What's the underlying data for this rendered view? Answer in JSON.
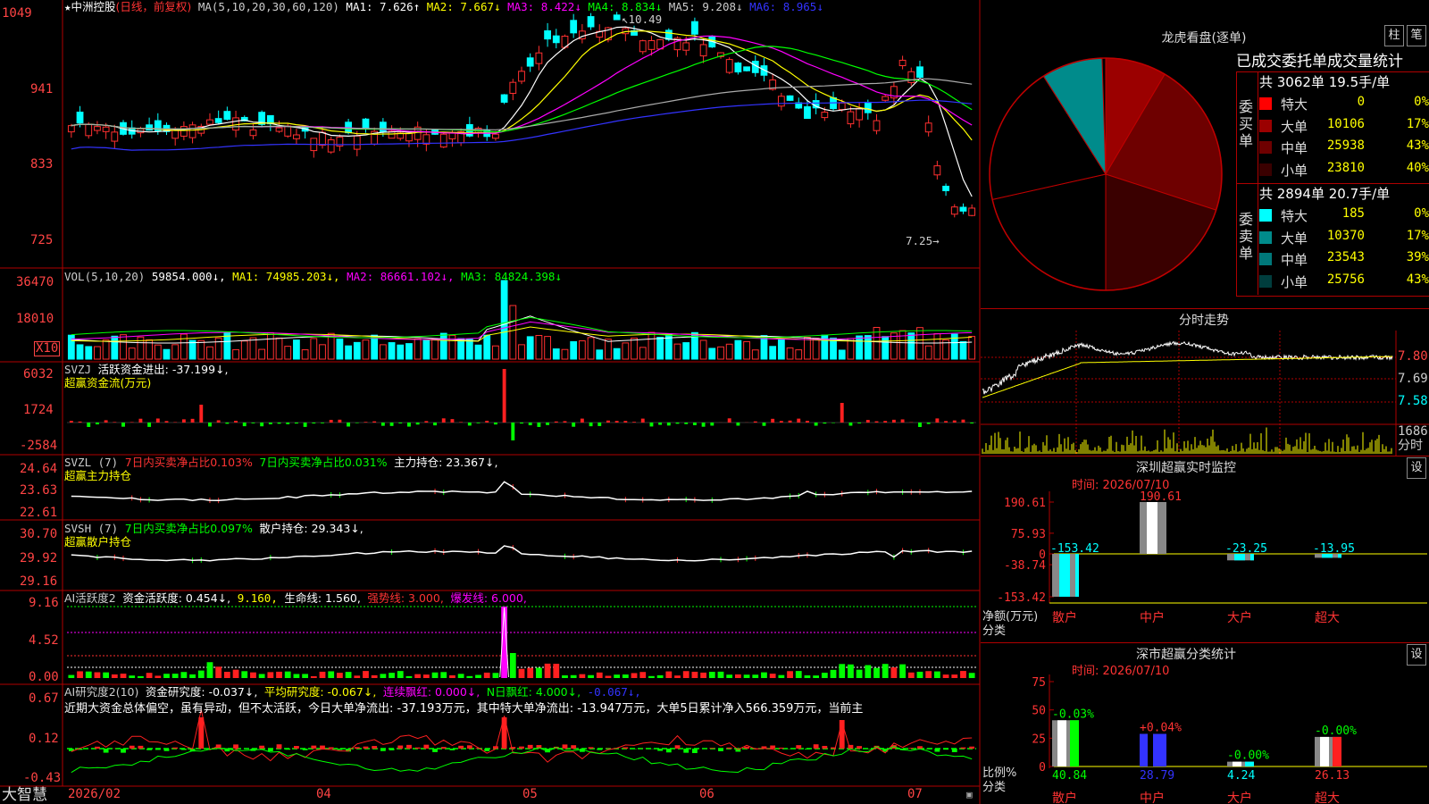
{
  "stock": {
    "name": "中洲控股",
    "mode": "(日线，前复权)",
    "ma_header": "MA(5,10,20,30,60,120)",
    "ma1": "MA1: 7.626↑",
    "ma2": "MA2: 7.667↓",
    "ma3": "MA3: 8.422↓",
    "ma4": "MA4: 8.834↓",
    "ma5": "MA5: 9.208↓",
    "ma6": "MA6: 8.965↓",
    "high_label": "10.49",
    "low_label": "7.25"
  },
  "price_axis": [
    "1049",
    "941",
    "833",
    "725"
  ],
  "vol": {
    "header": "VOL(5,10,20)",
    "v": "59854.000↓,",
    "ma1": "MA1: 74985.203↓,",
    "ma2": "MA2: 86661.102↓,",
    "ma3": "MA3: 84824.398↓",
    "axis": [
      "36470",
      "18010"
    ],
    "unit": "X10"
  },
  "svzj": {
    "header": "SVZJ",
    "line": "活跃资金进出: -37.199↓,",
    "sub": "超赢资金流(万元)",
    "axis": [
      "6032",
      "1724",
      "-2584"
    ]
  },
  "svzl": {
    "header": "SVZL (7)",
    "p1": "7日内买卖净占比0.103%",
    "p2": "7日内买卖净占比0.031%",
    "p3": "主力持仓: 23.367↓,",
    "sub": "超赢主力持仓",
    "axis": [
      "24.64",
      "23.63",
      "22.61"
    ]
  },
  "svsh": {
    "header": "SVSH (7)",
    "p1": "7日内买卖净占比0.097%",
    "p2": "散户持仓: 29.343↓,",
    "sub": "超赢散户持仓",
    "axis": [
      "30.70",
      "29.92",
      "29.16"
    ]
  },
  "ai1": {
    "header": "AI活跃度2",
    "p1": "资金活跃度: 0.454↓,",
    "p2": "9.160,",
    "p3": "生命线: 1.560,",
    "p4": "强势线: 3.000,",
    "p5": "爆发线: 6.000,",
    "axis": [
      "9.16",
      "4.52",
      "0.00"
    ]
  },
  "ai2": {
    "header": "AI研究度2(10)",
    "p1": "资金研究度: -0.037↓,",
    "p2": "平均研究度: -0.067↓,",
    "p3": "连续飘红: 0.000↓,",
    "p4": "N日飘红: 4.000↓,",
    "p5": "-0.067↓,",
    "desc": "近期大资金总体偏空，虽有异动，但不太活跃，今日大单净流出: -37.193万元，其中特大单净流出: -13.947万元，大单5日累计净入566.359万元，当前主",
    "axis": [
      "0.67",
      "0.12",
      "-0.43"
    ]
  },
  "bottom": {
    "brand": "大智慧",
    "dates": [
      "2026/02",
      "04",
      "05",
      "06",
      "07"
    ]
  },
  "dragon": {
    "title": "龙虎看盘(逐单)",
    "btn1": "柱",
    "btn2": "笔",
    "subtitle": "已成交委托单成交量统计",
    "buy_label": "委买单",
    "sell_label": "委卖单",
    "buy_total": "共 3062单 19.5手/单",
    "sell_total": "共 2894单 20.7手/单",
    "buy_rows": [
      {
        "name": "特大",
        "value": "0",
        "pct": "0%",
        "color": "#ff0000"
      },
      {
        "name": "大单",
        "value": "10106",
        "pct": "17%",
        "color": "#9b0000"
      },
      {
        "name": "中单",
        "value": "25938",
        "pct": "43%",
        "color": "#6e0000"
      },
      {
        "name": "小单",
        "value": "23810",
        "pct": "40%",
        "color": "#3a0000"
      }
    ],
    "sell_rows": [
      {
        "name": "特大",
        "value": "185",
        "pct": "0%",
        "color": "#00ffff"
      },
      {
        "name": "大单",
        "value": "10370",
        "pct": "17%",
        "color": "#008b8b"
      },
      {
        "name": "中单",
        "value": "23543",
        "pct": "39%",
        "color": "#00787a"
      },
      {
        "name": "小单",
        "value": "25756",
        "pct": "43%",
        "color": "#003d3d"
      }
    ]
  },
  "intraday": {
    "title": "分时走势",
    "axis": [
      "7.80",
      "7.69",
      "7.58"
    ],
    "vol_axis": "1686",
    "vol_unit": "分时"
  },
  "sz_monitor": {
    "title": "深圳超赢实时监控",
    "btn": "设",
    "time": "时间: 2026/07/10",
    "axis": [
      "190.61",
      "75.93",
      "0",
      "-38.74",
      "-153.42"
    ],
    "ylabel": "净额(万元)",
    "xlabel": "分类",
    "cats": [
      "散户",
      "中户",
      "大户",
      "超大"
    ],
    "values": [
      -153.42,
      190.61,
      -23.25,
      -13.95
    ],
    "labels": [
      "-153.42",
      "190.61",
      "-23.25",
      "-13.95"
    ]
  },
  "sz_stats": {
    "title": "深市超赢分类统计",
    "btn": "设",
    "time": "时间: 2026/07/10",
    "axis": [
      "75",
      "50",
      "25",
      "0"
    ],
    "ylabel": "比例%",
    "xlabel": "分类",
    "cats": [
      "散户",
      "中户",
      "大户",
      "超大"
    ],
    "values": [
      40.84,
      28.79,
      4.24,
      26.13
    ],
    "labels": [
      "40.84",
      "28.79",
      "4.24",
      "26.13"
    ],
    "top_labels": [
      "-0.03%",
      "+0.04%",
      "-0.00%",
      "-0.00%"
    ],
    "colors": [
      "#00ff00",
      "#3333ff",
      "#00ffff",
      "#ff2020"
    ]
  }
}
